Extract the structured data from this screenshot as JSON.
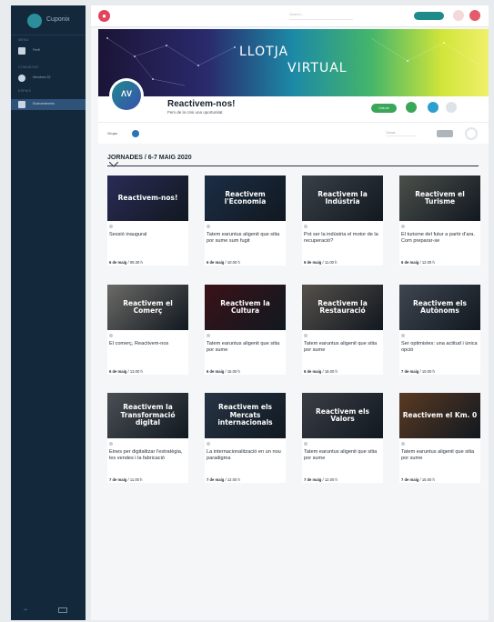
{
  "app": {
    "brand": "Cuponix"
  },
  "sidebar": {
    "sections": [
      "MENU",
      "COMUNITAT",
      "ESPAIS"
    ],
    "items": [
      {
        "label": "Perfil",
        "icon": "user-icon"
      },
      {
        "label": "Membres 32",
        "icon": "people-icon"
      },
      {
        "label": "Esdeveniments",
        "icon": "calendar-icon"
      }
    ]
  },
  "topbar": {
    "search_placeholder": "Search..."
  },
  "banner": {
    "title_line1": "LLOTJA",
    "title_line2": "VIRTUAL"
  },
  "profile": {
    "avatar_text": "ΛV",
    "name": "Reactivem-nos!",
    "subtitle": "Fem de la crisi una oportunitat",
    "action_label": "Unir-se"
  },
  "filter": {
    "label": "Grups",
    "search_placeholder": "Cercar..."
  },
  "section": {
    "title": "JORNADES / 6-7 MAIG 2020"
  },
  "cards": [
    {
      "thumb": "Reactivem-nos!",
      "desc": "Sessió inaugural",
      "date": "6 de maig",
      "time": "09.30 h",
      "bg": "#2a2b56"
    },
    {
      "thumb": "Reactivem l'Economia",
      "desc": "Tatem earuntus aligenit que sitia por sume sum fugit",
      "date": "6 de maig",
      "time": "10.00 h",
      "bg": "#1b2e45"
    },
    {
      "thumb": "Reactivem la Indústria",
      "desc": "Pot ser la indústria el motor de la recuperació?",
      "date": "6 de maig",
      "time": "11.00 h",
      "bg": "#3a4048"
    },
    {
      "thumb": "Reactivem el Turisme",
      "desc": "El turisme del futur a partir d'ara. Com preparar-se",
      "date": "6 de maig",
      "time": "12.00 h",
      "bg": "#4b4f4a"
    },
    {
      "thumb": "Reactivem el Comerç",
      "desc": "El comerç, Reactivem-nos",
      "date": "6 de maig",
      "time": "13.00 h",
      "bg": "#6b6a66"
    },
    {
      "thumb": "Reactivem la Cultura",
      "desc": "Tatem earuntus aligenit que sitia por sume",
      "date": "6 de maig",
      "time": "15.00 h",
      "bg": "#3a1218"
    },
    {
      "thumb": "Reactivem la Restauració",
      "desc": "Tatem earuntus aligenit que sitia por sume",
      "date": "6 de maig",
      "time": "16.00 h",
      "bg": "#55504a"
    },
    {
      "thumb": "Reactivem els Autònoms",
      "desc": "Ser optimistes: una actitud i única opció",
      "date": "7 de maig",
      "time": "10.00 h",
      "bg": "#3e4650"
    },
    {
      "thumb": "Reactivem la Transformació digital",
      "desc": "Eines per digitalitzar l'estratègia, les vendes i la fabricació",
      "date": "7 de maig",
      "time": "11.00 h",
      "bg": "#4a4f54"
    },
    {
      "thumb": "Reactivem els Mercats internacionals",
      "desc": "La internacionalització en un nou paradigma",
      "date": "7 de maig",
      "time": "12.00 h",
      "bg": "#263445"
    },
    {
      "thumb": "Reactivem els Valors",
      "desc": "Tatem earuntus aligenit que sitia por sume",
      "date": "7 de maig",
      "time": "12.00 h",
      "bg": "#3b3e45"
    },
    {
      "thumb": "Reactivem el Km. 0",
      "desc": "Tatem earuntus aligenit que sitia por sume",
      "date": "7 de maig",
      "time": "15.00 h",
      "bg": "#5a3a22"
    }
  ]
}
